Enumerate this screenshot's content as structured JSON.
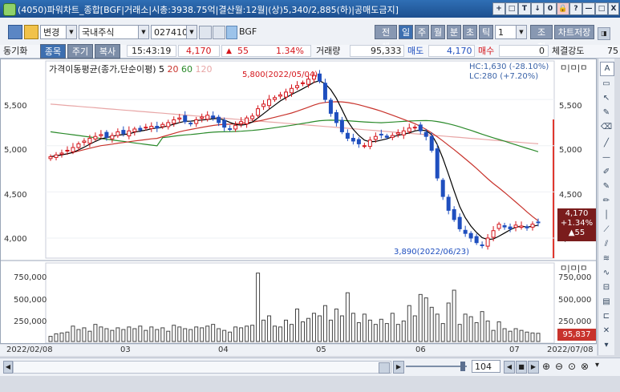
{
  "window": {
    "title": "(4050)파워차트_종합[BGF|거래소|시총:3938.75억|결산월:12월|(상)5,340/2,885(하)|공매도금지]",
    "title_buttons": [
      "+",
      "□",
      "T",
      "↓",
      "0",
      "🔒",
      "?",
      "—",
      "□",
      "X"
    ]
  },
  "toolbar": {
    "change_label": "변경",
    "market_select": "국내주식",
    "code_value": "027410",
    "stock_name": "BGF",
    "period_buttons": [
      "전체",
      "일",
      "주",
      "월",
      "분",
      "초",
      "틱"
    ],
    "active_period": "일",
    "interval_value": "1",
    "query_label": "조회",
    "save_label": "차트저장"
  },
  "quotebar": {
    "sync_label": "동기화",
    "tabs": [
      "종목",
      "주기",
      "복사"
    ],
    "time": "15:43:19",
    "price": "4,170",
    "change_arrow": "▲",
    "change": "55",
    "change_pct": "1.34%",
    "volume_label": "거래량",
    "volume": "95,333",
    "ask_label": "매도",
    "ask": "4,170",
    "bid_label": "매수",
    "bid": "0",
    "strength_label": "체결강도",
    "strength": "75"
  },
  "price_chart": {
    "legend_title": "가격이동평균(종가,단순이평)",
    "ma_labels": [
      "5",
      "20",
      "60",
      "120"
    ],
    "ma_colors": [
      "#000000",
      "#c8332c",
      "#2a8a2a",
      "#e8a6a6"
    ],
    "hc_text": "HC:1,630 (-28.10%)",
    "lc_text": "LC:280 (+7.20%)",
    "high_annotation": "5,800(2022/05/04)",
    "low_annotation": "3,890(2022/06/23)",
    "y_ticks": [
      "5,500",
      "5,000",
      "4,500",
      "4,000"
    ],
    "last_price_box": [
      "4,170",
      "+1.34%",
      "▲55"
    ],
    "corner_label": "ㅁ|ㅁ|ㅁ"
  },
  "volume_chart": {
    "y_ticks": [
      "750,000",
      "500,000",
      "250,000"
    ],
    "last_volume_box": "95,837",
    "corner_label": "ㅁ|ㅁ|ㅁ"
  },
  "x_axis": {
    "start_date": "2022/02/08",
    "end_date": "2022/07/08",
    "months": [
      "03",
      "04",
      "05",
      "06",
      "07"
    ]
  },
  "bottom_bar": {
    "visible_count": "104"
  },
  "chart_data": {
    "type": "candlestick",
    "x_range": [
      "2022/02/08",
      "2022/07/08"
    ],
    "ylim": [
      3800,
      5900
    ],
    "moving_averages": [
      {
        "name": "5",
        "color": "#000000"
      },
      {
        "name": "20",
        "color": "#c8332c"
      },
      {
        "name": "60",
        "color": "#2a8a2a"
      },
      {
        "name": "120",
        "color": "#e8a6a6"
      }
    ],
    "close_approx": [
      4880,
      4900,
      4920,
      4950,
      4980,
      5020,
      5050,
      5080,
      5100,
      5120,
      5090,
      5110,
      5150,
      5130,
      5160,
      5180,
      5170,
      5200,
      5210,
      5190,
      5230,
      5250,
      5280,
      5300,
      5260,
      5240,
      5280,
      5310,
      5330,
      5300,
      5250,
      5200,
      5180,
      5220,
      5260,
      5300,
      5320,
      5400,
      5450,
      5500,
      5520,
      5550,
      5580,
      5620,
      5650,
      5680,
      5720,
      5760,
      5700,
      5500,
      5350,
      5250,
      5150,
      5080,
      5050,
      5020,
      5000,
      5060,
      5100,
      5120,
      5090,
      5110,
      5140,
      5160,
      5190,
      5200,
      5160,
      5100,
      4950,
      4650,
      4450,
      4300,
      4200,
      4100,
      4050,
      4000,
      3950,
      3920,
      4000,
      4080,
      4150,
      4120,
      4100,
      4140,
      4130,
      4110,
      4150,
      4170
    ],
    "volume_approx": [
      60000,
      90000,
      100000,
      110000,
      180000,
      140000,
      160000,
      120000,
      200000,
      170000,
      150000,
      130000,
      160000,
      140000,
      170000,
      150000,
      180000,
      130000,
      170000,
      140000,
      160000,
      120000,
      190000,
      170000,
      150000,
      140000,
      170000,
      160000,
      180000,
      200000,
      150000,
      130000,
      110000,
      170000,
      160000,
      180000,
      190000,
      800000,
      250000,
      300000,
      180000,
      170000,
      250000,
      200000,
      380000,
      230000,
      270000,
      330000,
      300000,
      420000,
      250000,
      380000,
      300000,
      570000,
      330000,
      220000,
      320000,
      250000,
      200000,
      260000,
      210000,
      330000,
      200000,
      240000,
      420000,
      300000,
      550000,
      510000,
      400000,
      320000,
      210000,
      450000,
      600000,
      200000,
      320000,
      290000,
      220000,
      350000,
      240000,
      130000,
      230000,
      150000,
      120000,
      150000,
      130000,
      110000,
      100000,
      95837
    ]
  }
}
